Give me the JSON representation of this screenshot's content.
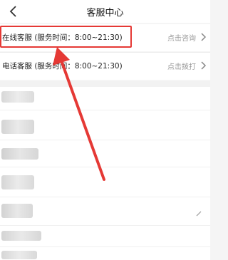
{
  "header": {
    "title": "客服中心",
    "back_icon": "chevron-left-icon"
  },
  "services": [
    {
      "label": "在线客服 (服务时间：8:00~21:30)",
      "action": "点击咨询"
    },
    {
      "label": "电话客服 (服务时间：8:00~21:30)",
      "action": "点击拨打"
    }
  ],
  "colors": {
    "highlight": "#e53935",
    "action_text": "#9a9a9a",
    "background": "#f5f5f5"
  },
  "blurred_rows": 7
}
